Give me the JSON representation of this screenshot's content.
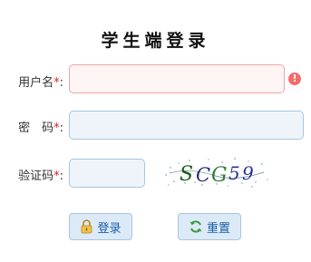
{
  "title": "学生端登录",
  "username": {
    "label": "用户名",
    "required_mark": "*",
    "colon": ":",
    "value": "",
    "placeholder": ""
  },
  "password": {
    "label": "密　码",
    "required_mark": "*",
    "colon": ":",
    "value": "",
    "placeholder": ""
  },
  "captcha": {
    "label": "验证码",
    "required_mark": "*",
    "colon": ":",
    "value": "",
    "placeholder": "",
    "image_text": "SCG59"
  },
  "error_icon": {
    "symbol": "!"
  },
  "buttons": {
    "login": "登录",
    "reset": "重置"
  },
  "icons": {
    "login": "lock-icon",
    "reset": "refresh-icon"
  }
}
